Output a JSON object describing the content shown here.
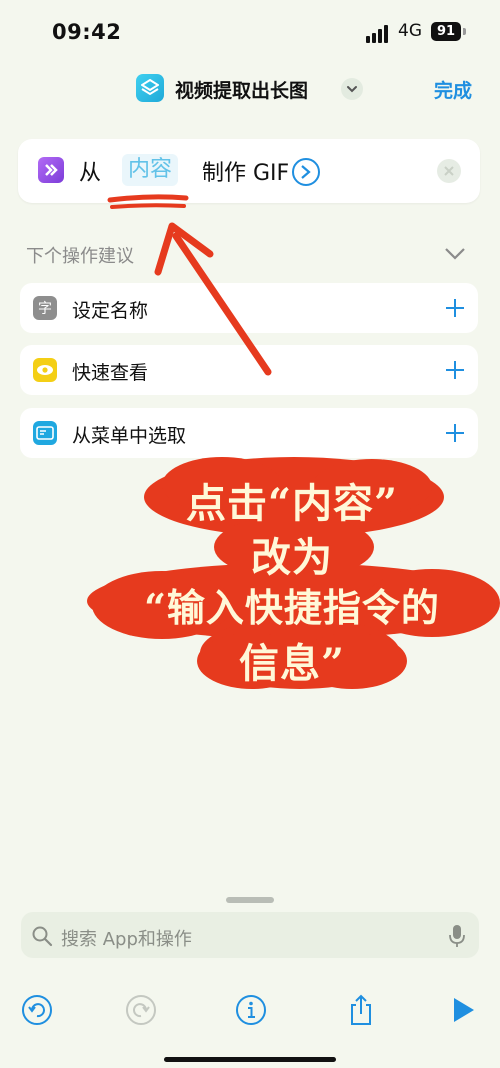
{
  "status": {
    "time": "09:42",
    "network": "4G",
    "battery": "91"
  },
  "header": {
    "title": "视频提取出长图",
    "done_label": "完成"
  },
  "action": {
    "from": "从",
    "content_token": "内容",
    "make": "制作 GIF"
  },
  "suggestions": {
    "heading": "下个操作建议",
    "items": [
      {
        "label": "设定名称",
        "icon": "text-icon",
        "color": "#8e8e8e"
      },
      {
        "label": "快速查看",
        "icon": "eye-icon",
        "color": "#f4cf15"
      },
      {
        "label": "从菜单中选取",
        "icon": "menu-icon",
        "color": "#20a8e0"
      }
    ]
  },
  "annotation": {
    "lines": [
      "点击“内容”",
      "改为",
      "“输入快捷指令的",
      "信息”"
    ],
    "color": "#e63a1e"
  },
  "search": {
    "placeholder": "搜索 App和操作"
  },
  "colors": {
    "accent": "#1f8fe0",
    "annotation_red": "#e63a1e"
  }
}
